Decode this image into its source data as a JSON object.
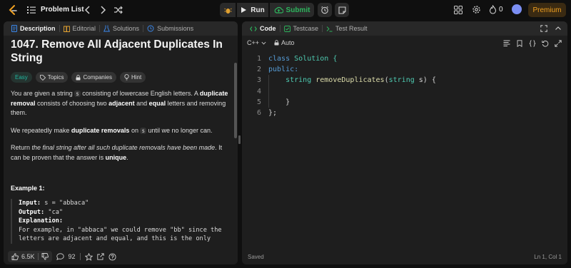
{
  "topbar": {
    "problem_list_label": "Problem List",
    "run_label": "Run",
    "submit_label": "Submit",
    "fire_count": "0",
    "premium_label": "Premium"
  },
  "left_tabs": [
    {
      "label": "Description",
      "icon": "description-icon"
    },
    {
      "label": "Editorial",
      "icon": "book-icon"
    },
    {
      "label": "Solutions",
      "icon": "flask-icon"
    },
    {
      "label": "Submissions",
      "icon": "history-icon"
    }
  ],
  "problem": {
    "title": "1047. Remove All Adjacent Duplicates In String",
    "chips": {
      "difficulty": "Easy",
      "topics": "Topics",
      "companies": "Companies",
      "hint": "Hint"
    },
    "p1": {
      "t1": "You are given a string ",
      "code1": "s",
      "t2": " consisting of lowercase English letters. A ",
      "b1": "duplicate removal",
      "t3": " consists of choosing two ",
      "b2": "adjacent",
      "t4": " and ",
      "b3": "equal",
      "t5": " letters and removing them."
    },
    "p2": {
      "t1": "We repeatedly make ",
      "b1": "duplicate removals",
      "t2": " on ",
      "code1": "s",
      "t3": " until we no longer can."
    },
    "p3": {
      "t1": "Return ",
      "i1": "the final string after all such duplicate removals have been made",
      "t2": ". It can be proven that the answer is ",
      "b1": "unique",
      "t3": "."
    },
    "example": {
      "title": "Example 1:",
      "input_label": "Input:",
      "input_value": " s = \"abbaca\"",
      "output_label": "Output:",
      "output_value": " \"ca\"",
      "explanation_label": "Explanation:",
      "explanation_line1": "For example, in \"abbaca\" we could remove \"bb\" since the",
      "explanation_line2": "letters are adjacent and equal, and this is the only"
    }
  },
  "footer_left": {
    "likes": "6.5K",
    "comments": "92"
  },
  "right_tabs": [
    {
      "label": "Code",
      "icon": "code-icon"
    },
    {
      "label": "Testcase",
      "icon": "checkbox-icon"
    },
    {
      "label": "Test Result",
      "icon": "terminal-icon"
    }
  ],
  "editor": {
    "language": "C++",
    "mode": "Auto",
    "lines": [
      {
        "n": "1"
      },
      {
        "n": "2"
      },
      {
        "n": "3"
      },
      {
        "n": "4"
      },
      {
        "n": "5"
      },
      {
        "n": "6"
      }
    ],
    "tok": {
      "class_kw": "class",
      "class_name": " Solution {",
      "public_kw": "public:",
      "indent": "    ",
      "string_type": "string",
      "fn_name": " removeDuplicates",
      "params_open": "(",
      "param_type": "string",
      "params_rest": " s) {",
      "close_inner": "    }",
      "close_outer": "};"
    },
    "status": "Saved",
    "cursor": "Ln 1, Col 1"
  },
  "colors": {
    "accent_green": "#2db55d",
    "easy_teal": "#20b8a0",
    "premium_orange": "#f0a020",
    "keyword_blue": "#569cd6"
  }
}
